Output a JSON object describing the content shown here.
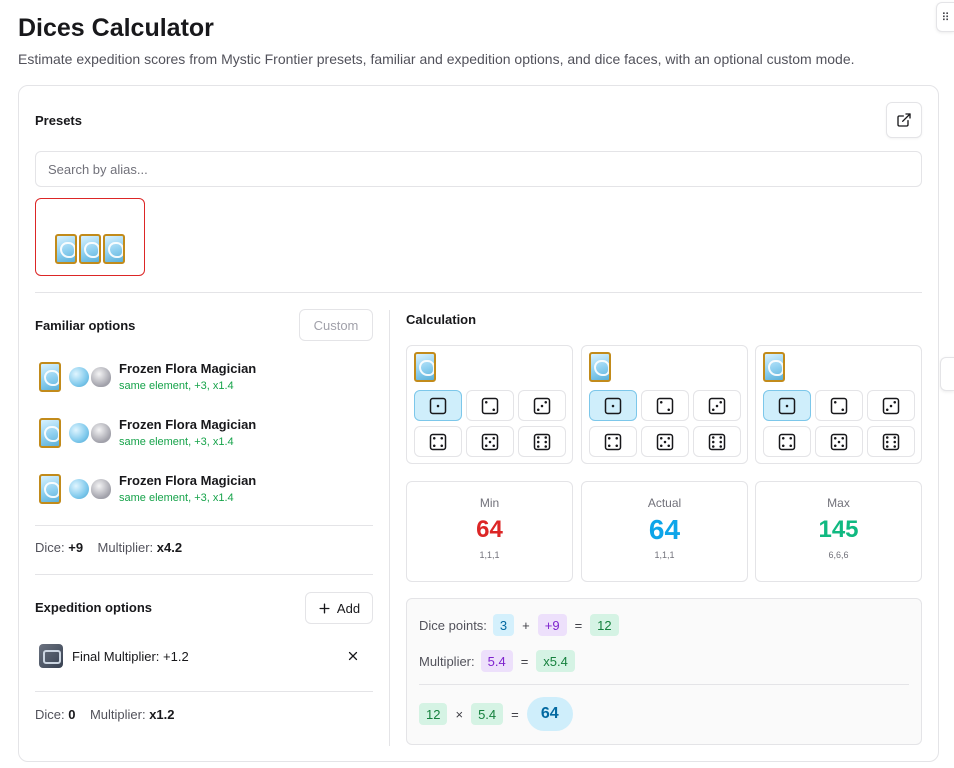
{
  "page": {
    "title": "Dices Calculator",
    "subtitle": "Estimate expedition scores from Mystic Frontier presets, familiar and expedition options, and dice faces, with an optional custom mode."
  },
  "presets": {
    "heading": "Presets",
    "search_placeholder": "Search by alias...",
    "open_icon": "external-link-icon",
    "items": [
      {
        "cards": [
          "frozen-flora-card-icon",
          "frozen-flora-card-icon",
          "frozen-flora-card-icon"
        ]
      }
    ]
  },
  "familiar": {
    "heading": "Familiar options",
    "custom_label": "Custom",
    "items": [
      {
        "name": "Frozen Flora Magician",
        "desc": "same element, +3, x1.4"
      },
      {
        "name": "Frozen Flora Magician",
        "desc": "same element, +3, x1.4"
      },
      {
        "name": "Frozen Flora Magician",
        "desc": "same element, +3, x1.4"
      }
    ],
    "dice_label": "Dice:",
    "dice_value": "+9",
    "mult_label": "Multiplier:",
    "mult_value": "x4.2"
  },
  "expedition": {
    "heading": "Expedition options",
    "add_label": "Add",
    "items": [
      {
        "label": "Final Multiplier: +1.2"
      }
    ],
    "dice_label": "Dice:",
    "dice_value": "0",
    "mult_label": "Multiplier:",
    "mult_value": "x1.2"
  },
  "calculation": {
    "heading": "Calculation",
    "dice_sets": [
      {
        "selected_face": 1,
        "faces": [
          1,
          2,
          3,
          4,
          5,
          6
        ]
      },
      {
        "selected_face": 1,
        "faces": [
          1,
          2,
          3,
          4,
          5,
          6
        ]
      },
      {
        "selected_face": 1,
        "faces": [
          1,
          2,
          3,
          4,
          5,
          6
        ]
      }
    ],
    "results": {
      "min": {
        "label": "Min",
        "value": "64",
        "faces": "1,1,1",
        "color": "#dc2626"
      },
      "actual": {
        "label": "Actual",
        "value": "64",
        "faces": "1,1,1",
        "color": "#0ea5e9"
      },
      "max": {
        "label": "Max",
        "value": "145",
        "faces": "6,6,6",
        "color": "#10b981"
      }
    },
    "breakdown": {
      "dice_points_label": "Dice points:",
      "dice_points_base": "3",
      "plus": "+",
      "dice_points_bonus": "+9",
      "equals": "=",
      "dice_points_total": "12",
      "multiplier_label": "Multiplier:",
      "multiplier_value": "5.4",
      "multiplier_total": "x5.4",
      "final_a": "12",
      "times": "×",
      "final_b": "5.4",
      "final_result": "64"
    }
  }
}
